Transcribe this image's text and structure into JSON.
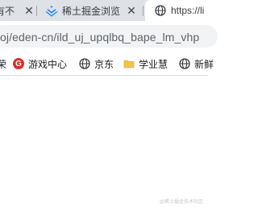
{
  "tabs": [
    {
      "label": "有不",
      "close": "✕",
      "icon": ""
    },
    {
      "label": "稀土掘金浏览",
      "close": "✕",
      "icon": "juejin-icon"
    },
    {
      "label": "https://li",
      "close": "",
      "icon": "globe-icon"
    }
  ],
  "address": {
    "url": "oj/eden-cn/ild_uj_upqlbq_bape_lm_vhp"
  },
  "bookmarks": [
    {
      "label": "荣",
      "icon": ""
    },
    {
      "label": "游戏中心",
      "icon": "game-center-icon"
    },
    {
      "label": "京东",
      "icon": "globe-icon"
    },
    {
      "label": "学业慧",
      "icon": "folder-icon"
    },
    {
      "label": "新鲜",
      "icon": "globe-icon"
    }
  ],
  "watermark": "@稀土掘金技术社区",
  "colors": {
    "tabstrip": "#dee1e6",
    "juejin_blue": "#1e80ff",
    "game_red": "#d93025",
    "folder_yellow": "#f5c24b"
  }
}
